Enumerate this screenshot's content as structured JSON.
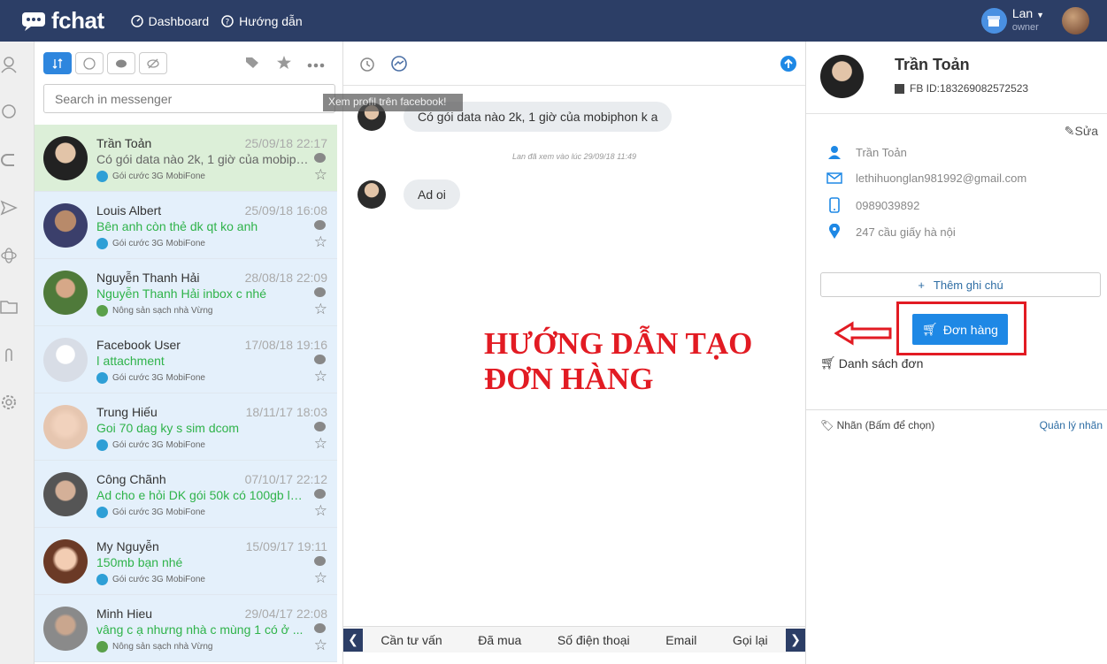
{
  "topbar": {
    "brand": "fchat",
    "nav": [
      {
        "label": "Dashboard",
        "icon": "dashboard-icon"
      },
      {
        "label": "Hướng dẫn",
        "icon": "help-icon"
      }
    ],
    "user": {
      "name": "Lan",
      "role": "owner"
    }
  },
  "tooltip": "Xem profil trên facebook!",
  "search": {
    "placeholder": "Search in messenger"
  },
  "conversations": [
    {
      "name": "Trần Toản",
      "date": "25/09/18 22:17",
      "message": "Có gói data nào 2k, 1 giờ của mobiphon k a",
      "page": "Gói cước 3G MobiFone"
    },
    {
      "name": "Louis Albert",
      "date": "25/09/18 16:08",
      "message": "Bên anh còn thẻ dk qt ko anh",
      "page": "Gói cước 3G MobiFone"
    },
    {
      "name": "Nguyễn Thanh Hải",
      "date": "28/08/18 22:09",
      "message": "Nguyễn Thanh Hải inbox c nhé",
      "page": "Nông sản sạch nhà Vừng"
    },
    {
      "name": "Facebook User",
      "date": "17/08/18 19:16",
      "message": "attachment",
      "page": "Gói cước 3G MobiFone"
    },
    {
      "name": "Trung Hiếu",
      "date": "18/11/17 18:03",
      "message": "Goi 70 dag ky s sim dcom",
      "page": "Gói cước 3G MobiFone"
    },
    {
      "name": "Công Chãnh",
      "date": "07/10/17 22:12",
      "message": "Ad cho e hỏi DK gói 50k có 100gb là ...",
      "page": "Gói cước 3G MobiFone"
    },
    {
      "name": "My Nguyễn",
      "date": "15/09/17 19:11",
      "message": "150mb bạn nhé",
      "page": "Gói cước 3G MobiFone"
    },
    {
      "name": "Minh Hieu",
      "date": "29/04/17 22:08",
      "message": "vâng c ạ nhưng nhà c mùng 1 có ở ...",
      "page": "Nông sản sạch nhà Vừng"
    }
  ],
  "chat": {
    "messages": [
      {
        "text": "Có gói data nào 2k, 1 giờ của mobiphon k a"
      },
      {
        "text": "Ad oi"
      }
    ],
    "seen": "Lan đã xem vào lúc 29/09/18 11:49",
    "guide_line1": "HƯỚNG DẪN TẠO",
    "guide_line2": "ĐƠN HÀNG",
    "quick_replies": [
      "Cần tư vấn",
      "Đã mua",
      "Số điện thoại",
      "Email",
      "Gọi lại"
    ]
  },
  "profile": {
    "name": "Trần Toản",
    "fb_id": "FB ID:183269082572523",
    "edit": "Sửa",
    "full_name": "Trần Toản",
    "email": "lethihuonglan981992@gmail.com",
    "phone": "0989039892",
    "address": "247 cầu giấy hà nội",
    "add_note": "Thêm ghi chú",
    "order_button": "Đơn hàng",
    "order_list": "Danh sách đơn",
    "labels": "Nhãn (Bấm để chọn)",
    "manage_labels": "Quản lý nhãn"
  }
}
